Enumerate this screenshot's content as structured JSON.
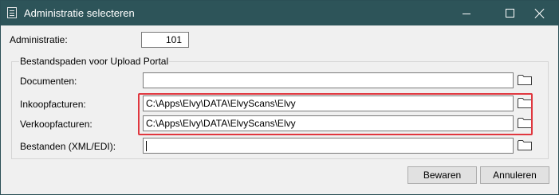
{
  "window": {
    "title": "Administratie selecteren"
  },
  "form": {
    "administratie_label": "Administratie:",
    "administratie_value": "101",
    "group_title": "Bestandspaden voor Upload Portal",
    "fields": [
      {
        "label": "Documenten:",
        "value": ""
      },
      {
        "label": "Inkoopfacturen:",
        "value": "C:\\Apps\\Elvy\\DATA\\ElvyScans\\Elvy"
      },
      {
        "label": "Verkoopfacturen:",
        "value": "C:\\Apps\\Elvy\\DATA\\ElvyScans\\Elvy"
      },
      {
        "label": "Bestanden (XML/EDI):",
        "value": ""
      }
    ]
  },
  "buttons": {
    "save": "Bewaren",
    "cancel": "Annuleren"
  },
  "colors": {
    "titlebar": "#2d5459",
    "highlight_border": "#e0373f",
    "dialog_background": "#f0f0f0"
  },
  "icons": {
    "app": "form-icon",
    "folder": "folder-icon",
    "minimize": "minimize-icon",
    "maximize": "maximize-icon",
    "close": "close-icon"
  }
}
